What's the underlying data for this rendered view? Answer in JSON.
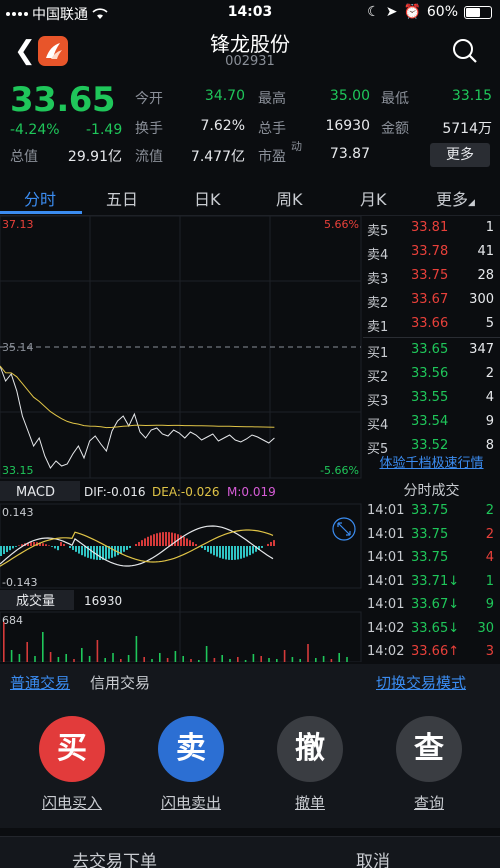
{
  "status": {
    "carrier": "中国联通",
    "time": "14:03",
    "battery": "60%",
    "battery_level": 0.6
  },
  "stock": {
    "name": "锋龙股份",
    "code": "002931"
  },
  "quote": {
    "price": "33.65",
    "change_pct": "-4.24%",
    "change": "-1.49",
    "open_label": "今开",
    "open": "34.70",
    "high_label": "最高",
    "high": "35.00",
    "low_label": "最低",
    "low": "33.15",
    "turnover_label": "换手",
    "turnover": "7.62%",
    "volume_label": "总手",
    "volume": "16930",
    "amount_label": "金额",
    "amount": "5714万",
    "mcap_label": "总值",
    "mcap": "29.91亿",
    "float_label": "流值",
    "float": "7.477亿",
    "pe_label": "市盈",
    "pe_sup": "动",
    "pe": "73.87",
    "more": "更多"
  },
  "tabs": [
    "分时",
    "五日",
    "日K",
    "周K",
    "月K",
    "更多"
  ],
  "chart": {
    "price_high": "37.13",
    "price_low": "33.15",
    "pct_high": "5.66%",
    "pct_low": "-5.66%",
    "prev_close": "35.14",
    "macd_label": "MACD",
    "dif": "DIF:-0.016",
    "dea": "DEA:-0.026",
    "m": "M:0.019",
    "macd_top": "0.143",
    "macd_bottom": "-0.143",
    "vol_label": "成交量",
    "vol_value": "16930",
    "vol_max": "684"
  },
  "orderbook": {
    "asks": [
      {
        "k": "卖5",
        "p": "33.81",
        "q": "1"
      },
      {
        "k": "卖4",
        "p": "33.78",
        "q": "41"
      },
      {
        "k": "卖3",
        "p": "33.75",
        "q": "28"
      },
      {
        "k": "卖2",
        "p": "33.67",
        "q": "300"
      },
      {
        "k": "卖1",
        "p": "33.66",
        "q": "5"
      }
    ],
    "bids": [
      {
        "k": "买1",
        "p": "33.65",
        "q": "347"
      },
      {
        "k": "买2",
        "p": "33.56",
        "q": "2"
      },
      {
        "k": "买3",
        "p": "33.55",
        "q": "4"
      },
      {
        "k": "买4",
        "p": "33.54",
        "q": "9"
      },
      {
        "k": "买5",
        "p": "33.52",
        "q": "8"
      }
    ],
    "experience": "体验千档极速行情"
  },
  "ticks": {
    "title": "分时成交",
    "rows": [
      {
        "t": "14:01",
        "p": "33.75",
        "v": "2"
      },
      {
        "t": "14:01",
        "p": "33.75",
        "v": "2"
      },
      {
        "t": "14:01",
        "p": "33.75",
        "v": "4"
      },
      {
        "t": "14:01",
        "p": "33.71↓",
        "v": "1"
      },
      {
        "t": "14:01",
        "p": "33.67↓",
        "v": "9"
      },
      {
        "t": "14:02",
        "p": "33.65↓",
        "v": "30"
      },
      {
        "t": "14:02",
        "p": "33.66↑",
        "v": "3"
      }
    ]
  },
  "trade": {
    "tab_normal": "普通交易",
    "tab_credit": "信用交易",
    "switch_mode": "切换交易模式",
    "buy_char": "买",
    "buy_label": "闪电买入",
    "sell_char": "卖",
    "sell_label": "闪电卖出",
    "cancel_char": "撤",
    "cancel_label": "撤单",
    "query_char": "查",
    "query_label": "查询",
    "order_link": "去交易下单",
    "cancel_btn": "取消"
  },
  "colors": {
    "up": "#e8403a",
    "down": "#1fc65a",
    "accent": "#3b8cf0",
    "buy": "#e83b3b",
    "sell": "#2a6fd6",
    "neutral": "#3a3d42"
  }
}
